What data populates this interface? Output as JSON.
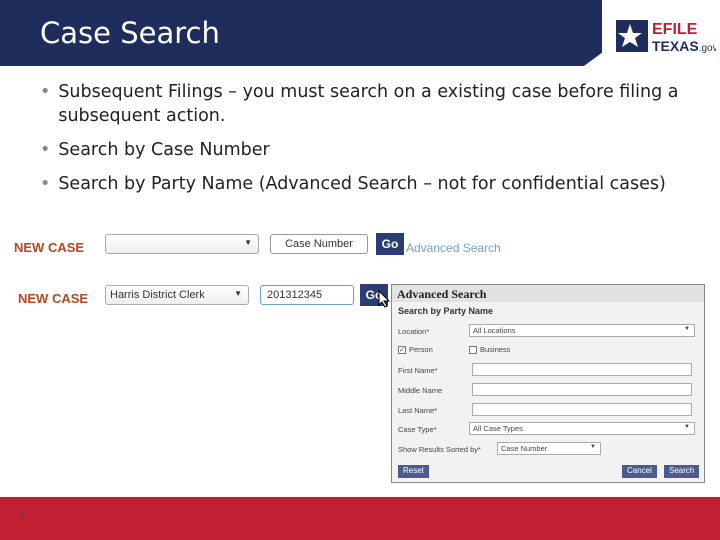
{
  "header": {
    "title": "Case Search",
    "logo_text": "EFILE TEXAS.gov"
  },
  "bullets": [
    "Subsequent Filings – you must search on a existing case before filing a subsequent action.",
    "Search by Case Number",
    "Search by Party Name (Advanced Search – not for confidential cases)"
  ],
  "row1": {
    "label": "NEW CASE",
    "location": "",
    "case_placeholder": "Case Number",
    "go": "Go",
    "advanced_link": "Advanced Search"
  },
  "row2": {
    "label": "NEW CASE",
    "location": "Harris District Clerk",
    "case_value": "201312345",
    "go": "Go"
  },
  "dialog": {
    "title": "Advanced Search",
    "subtitle": "Search by Party Name",
    "location_label": "Location*",
    "location_value": "All Locations",
    "person": "Person",
    "person_checked": true,
    "business": "Business",
    "business_checked": false,
    "first_name": "First Name*",
    "middle_name": "Middle Name",
    "last_name": "Last Name*",
    "case_type_label": "Case Type*",
    "case_type_value": "All Case Types",
    "sort_label": "Show Results Sorted by*",
    "sort_value": "Case Number",
    "reset": "Reset",
    "cancel": "Cancel",
    "search": "Search"
  },
  "footer": {
    "page_number": "3"
  },
  "colors": {
    "header": "#1f2d5c",
    "footer": "#c22032",
    "new_case": "#b8461b"
  }
}
